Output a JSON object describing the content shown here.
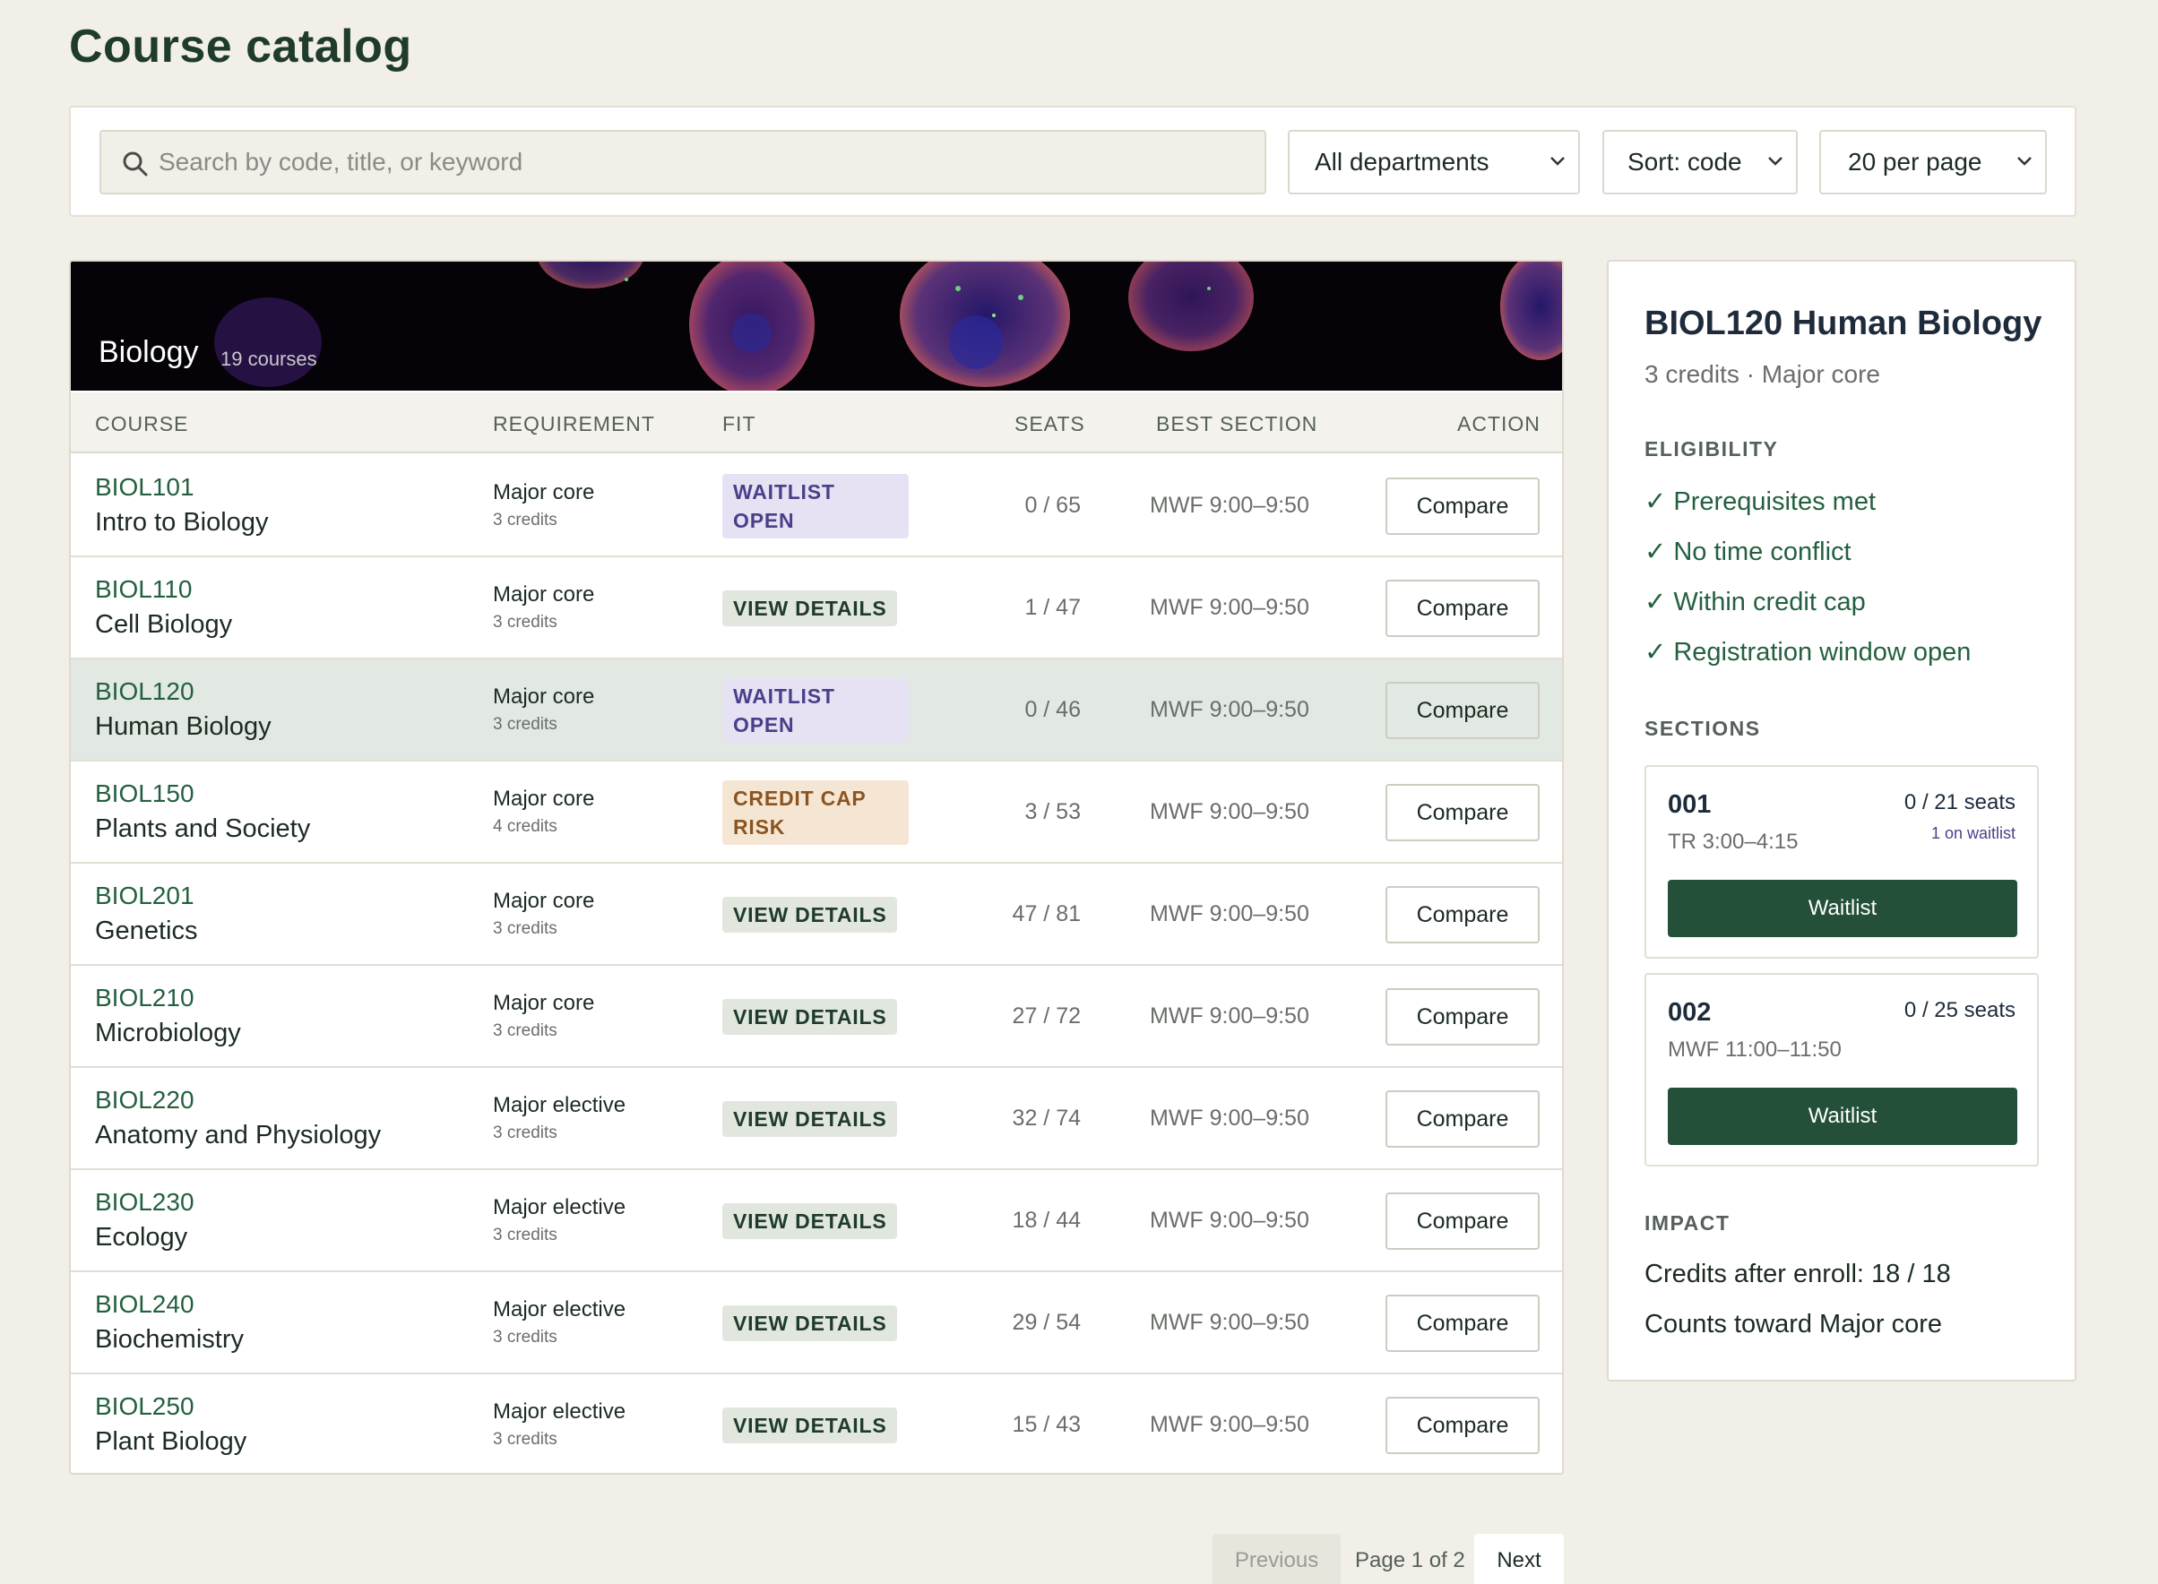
{
  "page": {
    "title": "Course catalog"
  },
  "filters": {
    "search_placeholder": "Search by code, title, or keyword",
    "department": "All departments",
    "sort": "Sort: code",
    "per_page": "20 per page"
  },
  "banner": {
    "title": "Biology",
    "count": "19 courses"
  },
  "table": {
    "headers": {
      "course": "COURSE",
      "requirement": "REQUIREMENT",
      "fit": "FIT",
      "seats": "SEATS",
      "best_section": "BEST SECTION",
      "action": "ACTION"
    },
    "rows": [
      {
        "code": "BIOL101",
        "title": "Intro to Biology",
        "req": "Major core",
        "credits": "3 credits",
        "fit": "WAITLIST OPEN",
        "fit_kind": "wait",
        "seats": "0 / 65",
        "section": "MWF 9:00–9:50",
        "action": "Compare",
        "selected": false
      },
      {
        "code": "BIOL110",
        "title": "Cell Biology",
        "req": "Major core",
        "credits": "3 credits",
        "fit": "VIEW DETAILS",
        "fit_kind": "view",
        "seats": "1 / 47",
        "section": "MWF 9:00–9:50",
        "action": "Compare",
        "selected": false
      },
      {
        "code": "BIOL120",
        "title": "Human Biology",
        "req": "Major core",
        "credits": "3 credits",
        "fit": "WAITLIST OPEN",
        "fit_kind": "wait",
        "seats": "0 / 46",
        "section": "MWF 9:00–9:50",
        "action": "Compare",
        "selected": true
      },
      {
        "code": "BIOL150",
        "title": "Plants and Society",
        "req": "Major core",
        "credits": "4 credits",
        "fit": "CREDIT CAP RISK",
        "fit_kind": "cap",
        "seats": "3 / 53",
        "section": "MWF 9:00–9:50",
        "action": "Compare",
        "selected": false
      },
      {
        "code": "BIOL201",
        "title": "Genetics",
        "req": "Major core",
        "credits": "3 credits",
        "fit": "VIEW DETAILS",
        "fit_kind": "view",
        "seats": "47 / 81",
        "section": "MWF 9:00–9:50",
        "action": "Compare",
        "selected": false
      },
      {
        "code": "BIOL210",
        "title": "Microbiology",
        "req": "Major core",
        "credits": "3 credits",
        "fit": "VIEW DETAILS",
        "fit_kind": "view",
        "seats": "27 / 72",
        "section": "MWF 9:00–9:50",
        "action": "Compare",
        "selected": false
      },
      {
        "code": "BIOL220",
        "title": "Anatomy and Physiology",
        "req": "Major elective",
        "credits": "3 credits",
        "fit": "VIEW DETAILS",
        "fit_kind": "view",
        "seats": "32 / 74",
        "section": "MWF 9:00–9:50",
        "action": "Compare",
        "selected": false
      },
      {
        "code": "BIOL230",
        "title": "Ecology",
        "req": "Major elective",
        "credits": "3 credits",
        "fit": "VIEW DETAILS",
        "fit_kind": "view",
        "seats": "18 / 44",
        "section": "MWF 9:00–9:50",
        "action": "Compare",
        "selected": false
      },
      {
        "code": "BIOL240",
        "title": "Biochemistry",
        "req": "Major elective",
        "credits": "3 credits",
        "fit": "VIEW DETAILS",
        "fit_kind": "view",
        "seats": "29 / 54",
        "section": "MWF 9:00–9:50",
        "action": "Compare",
        "selected": false
      },
      {
        "code": "BIOL250",
        "title": "Plant Biology",
        "req": "Major elective",
        "credits": "3 credits",
        "fit": "VIEW DETAILS",
        "fit_kind": "view",
        "seats": "15 / 43",
        "section": "MWF 9:00–9:50",
        "action": "Compare",
        "selected": false
      }
    ]
  },
  "pagination": {
    "previous": "Previous",
    "info": "Page 1 of 2",
    "next": "Next"
  },
  "detail": {
    "title": "BIOL120 Human Biology",
    "subtitle": "3 credits · Major core",
    "eligibility_heading": "ELIGIBILITY",
    "eligibility": [
      "✓ Prerequisites met",
      "✓ No time conflict",
      "✓ Within credit cap",
      "✓ Registration window open"
    ],
    "sections_heading": "SECTIONS",
    "sections": [
      {
        "number": "001",
        "seats": "0 / 21 seats",
        "waitlist": "1 on waitlist",
        "time": "TR 3:00–4:15",
        "button": "Waitlist"
      },
      {
        "number": "002",
        "seats": "0 / 25 seats",
        "waitlist": "",
        "time": "MWF 11:00–11:50",
        "button": "Waitlist"
      }
    ],
    "impact_heading": "IMPACT",
    "impact": [
      "Credits after enroll: 18 / 18",
      "Counts toward Major core"
    ]
  },
  "colors": {
    "accent": "#24603f",
    "button_dark": "#24503a",
    "waitlist_badge": "#e6e2f3",
    "cap_badge": "#f5e6d3",
    "view_badge": "#e1e6df",
    "selected_row": "#e2e9e2",
    "background": "#f2efe8"
  },
  "icons": {
    "search": "search-icon",
    "select": "chevron-down-icon",
    "check": "check-icon"
  }
}
